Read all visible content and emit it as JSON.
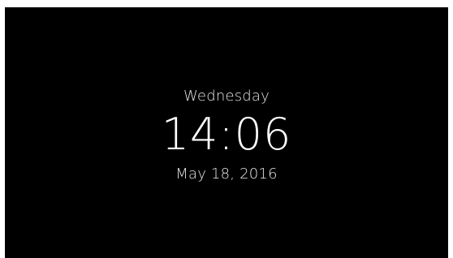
{
  "clock": {
    "day": "Wednesday",
    "time": "14:06",
    "date": "May 18, 2016"
  },
  "colors": {
    "background": "#000000",
    "text": "#ffffff"
  }
}
